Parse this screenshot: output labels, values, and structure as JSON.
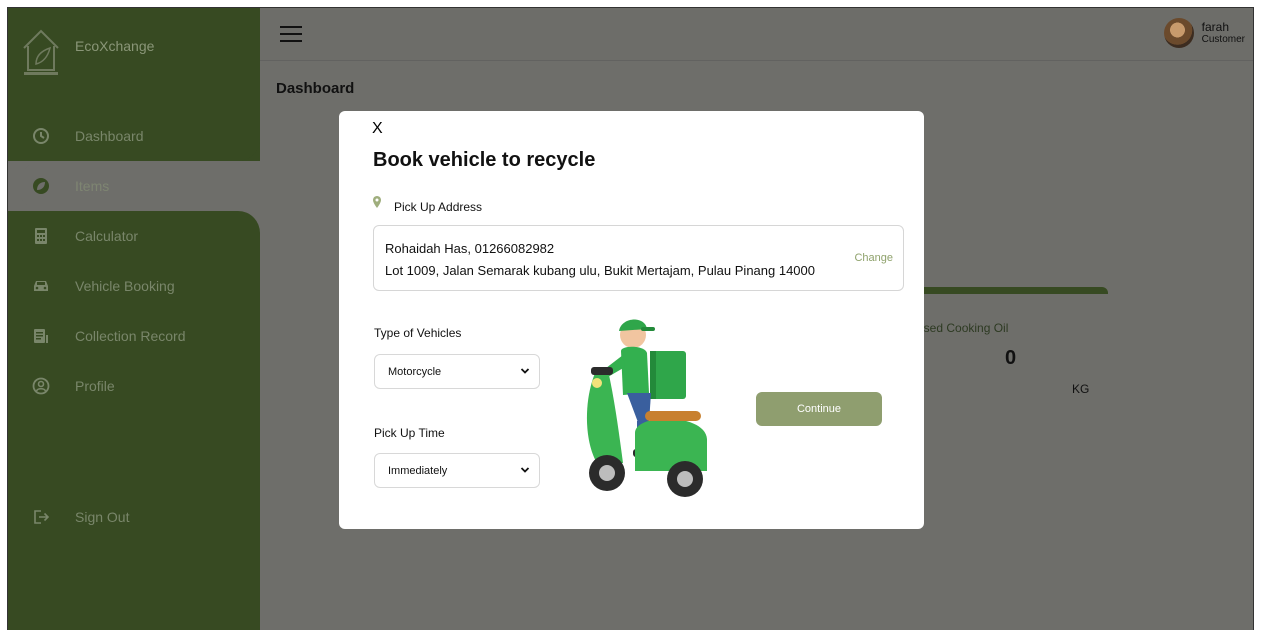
{
  "app": {
    "brand_name": "EcoXchange"
  },
  "sidebar": {
    "items": [
      {
        "label": "Dashboard",
        "icon": "dashboard-icon"
      },
      {
        "label": "Items",
        "icon": "leaf-icon"
      },
      {
        "label": "Calculator",
        "icon": "calculator-icon"
      },
      {
        "label": "Vehicle Booking",
        "icon": "car-icon"
      },
      {
        "label": "Collection Record",
        "icon": "record-icon"
      },
      {
        "label": "Profile",
        "icon": "profile-icon"
      }
    ],
    "sign_out": "Sign Out"
  },
  "header": {
    "user_name": "farah",
    "user_role": "Customer"
  },
  "page": {
    "title": "Dashboard"
  },
  "stat_card": {
    "label": "Used Cooking Oil",
    "value": "0",
    "unit": "KG"
  },
  "modal": {
    "close_label": "X",
    "title": "Book vehicle to recycle",
    "address_label": "Pick Up Address",
    "address_line1": "Rohaidah Has, 01266082982",
    "address_line2": "Lot 1009, Jalan Semarak kubang ulu, Bukit Mertajam, Pulau Pinang 14000",
    "change_label": "Change",
    "vehicle_label": "Type of Vehicles",
    "vehicle_selected": "Motorcycle",
    "time_label": "Pick Up Time",
    "time_selected": "Immediately",
    "continue_label": "Continue"
  },
  "colors": {
    "sidebar": "#374a22",
    "overlay": "#6e6e6a",
    "accent": "#8f9e6f",
    "link": "#8fa26c"
  }
}
